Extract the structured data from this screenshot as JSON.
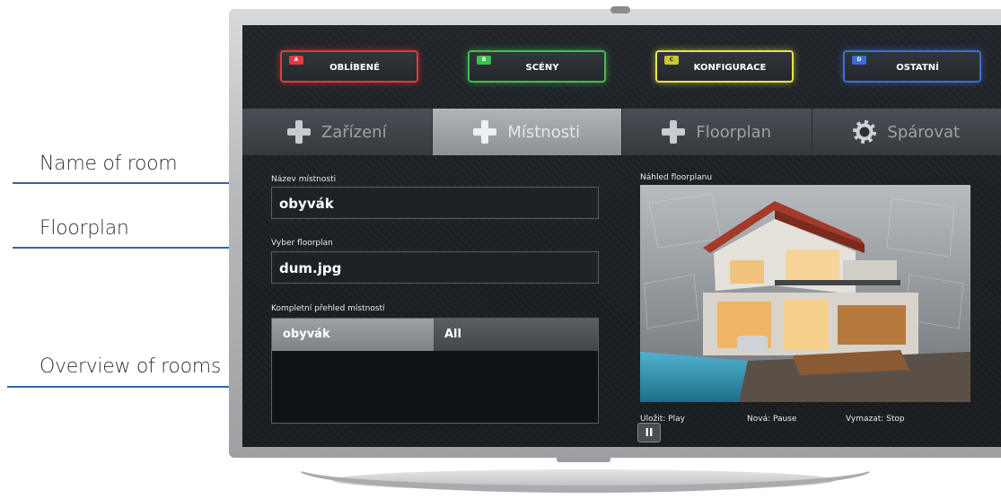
{
  "callouts": {
    "name_of_room": "Name of room",
    "floorplan": "Floorplan",
    "overview_of_rooms": "Overview of rooms"
  },
  "color_buttons": [
    {
      "key": "A",
      "label": "OBLÍBENÉ",
      "color": "#e03a3e"
    },
    {
      "key": "B",
      "label": "SCÉNY",
      "color": "#3fbf4c"
    },
    {
      "key": "C",
      "label": "KONFIGURACE",
      "color": "#e8e44a"
    },
    {
      "key": "D",
      "label": "OSTATNÍ",
      "color": "#3d6fd1"
    }
  ],
  "tabs": [
    {
      "label": "Zařízení",
      "icon": "plus-icon",
      "active": false
    },
    {
      "label": "Místnosti",
      "icon": "plus-icon",
      "active": true
    },
    {
      "label": "Floorplan",
      "icon": "plus-icon",
      "active": false
    },
    {
      "label": "Spárovat",
      "icon": "gear-icon",
      "active": false
    }
  ],
  "form": {
    "room_name_label": "Název místnosti",
    "room_name_value": "obyvák",
    "floorplan_label": "Vyber floorplan",
    "floorplan_value": "dum.jpg",
    "overview_label": "Kompletní přehled místností",
    "overview_columns": [
      "obyvák",
      "All"
    ]
  },
  "preview": {
    "label": "Náhled floorplanu"
  },
  "hints": {
    "save": "Uložit: Play",
    "new": "Nová: Pause",
    "delete": "Vymazat: Stop"
  },
  "pause_icon": "pause-icon"
}
